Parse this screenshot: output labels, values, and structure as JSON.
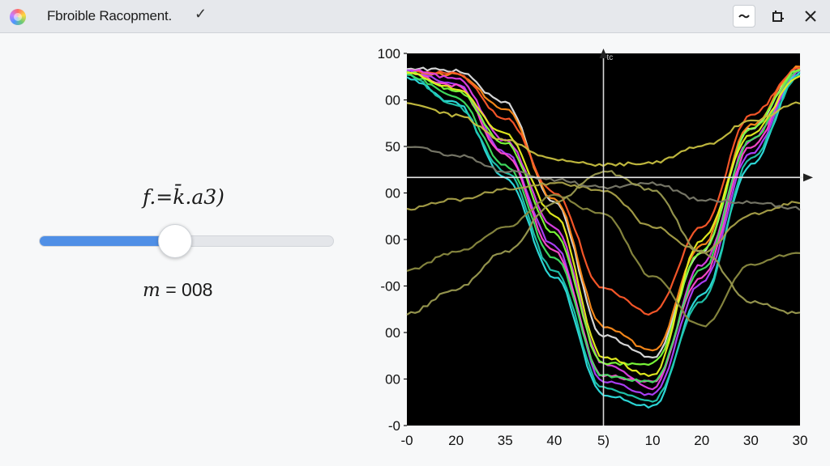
{
  "window": {
    "title": "Fbroible Racopment."
  },
  "controls": {
    "formula": "f.=k̄.a3)",
    "readout_symbol": "m",
    "readout_eq": "=",
    "readout_value": "008",
    "slider_level": 0.46
  },
  "chart_data": {
    "type": "line",
    "title": "",
    "xlabel": "",
    "ylabel": "",
    "axis_caption": "tc",
    "x_tick_labels": [
      "-0",
      "20",
      "35",
      "40",
      "5)",
      "10",
      "20",
      "30",
      "30"
    ],
    "y_tick_labels": [
      "100",
      "00",
      "50",
      "00",
      "00",
      "-00",
      "00",
      "00",
      "-0"
    ],
    "x": [
      0,
      1,
      2,
      3,
      4,
      5,
      6,
      7,
      8
    ],
    "series": [
      {
        "color": "#e0e0e0",
        "values": [
          88,
          86,
          60,
          -20,
          -128,
          -145,
          -60,
          40,
          88
        ]
      },
      {
        "color": "#ff8c1a",
        "values": [
          85,
          83,
          55,
          -18,
          -120,
          -140,
          -55,
          42,
          90
        ]
      },
      {
        "color": "#ff5a2a",
        "values": [
          86,
          84,
          48,
          -12,
          -90,
          -110,
          -40,
          50,
          89
        ]
      },
      {
        "color": "#e040e8",
        "values": [
          87,
          80,
          30,
          -40,
          -150,
          -170,
          -70,
          30,
          88
        ]
      },
      {
        "color": "#b040ff",
        "values": [
          85,
          76,
          20,
          -55,
          -165,
          -175,
          -85,
          20,
          85
        ]
      },
      {
        "color": "#ff4ad0",
        "values": [
          84,
          74,
          18,
          -60,
          -160,
          -165,
          -80,
          25,
          86
        ]
      },
      {
        "color": "#2ee0e0",
        "values": [
          80,
          60,
          0,
          -80,
          -175,
          -185,
          -95,
          10,
          84
        ]
      },
      {
        "color": "#20c8b0",
        "values": [
          82,
          58,
          5,
          -75,
          -170,
          -180,
          -100,
          15,
          82
        ]
      },
      {
        "color": "#40e060",
        "values": [
          83,
          65,
          10,
          -65,
          -160,
          -165,
          -75,
          30,
          86
        ]
      },
      {
        "color": "#7dff3a",
        "values": [
          85,
          70,
          28,
          -45,
          -150,
          -150,
          -60,
          40,
          87
        ]
      },
      {
        "color": "#e8f020",
        "values": [
          84,
          72,
          35,
          -30,
          -145,
          -160,
          -50,
          35,
          82
        ]
      },
      {
        "color": "#c8c040",
        "values": [
          60,
          50,
          30,
          15,
          10,
          12,
          25,
          45,
          60
        ]
      },
      {
        "color": "#a8a048",
        "values": [
          -25,
          -18,
          -10,
          -5,
          -10,
          -40,
          -60,
          -30,
          -20
        ]
      },
      {
        "color": "#8a8a40",
        "values": [
          -75,
          -60,
          -40,
          -15,
          -30,
          -80,
          -120,
          -70,
          -60
        ]
      },
      {
        "color": "#7a7a6a",
        "values": [
          25,
          18,
          5,
          -2,
          -8,
          -5,
          -18,
          -20,
          -25
        ]
      },
      {
        "color": "#9a9a50",
        "values": [
          -110,
          -90,
          -60,
          -20,
          5,
          -10,
          -60,
          -100,
          -110
        ]
      }
    ]
  }
}
